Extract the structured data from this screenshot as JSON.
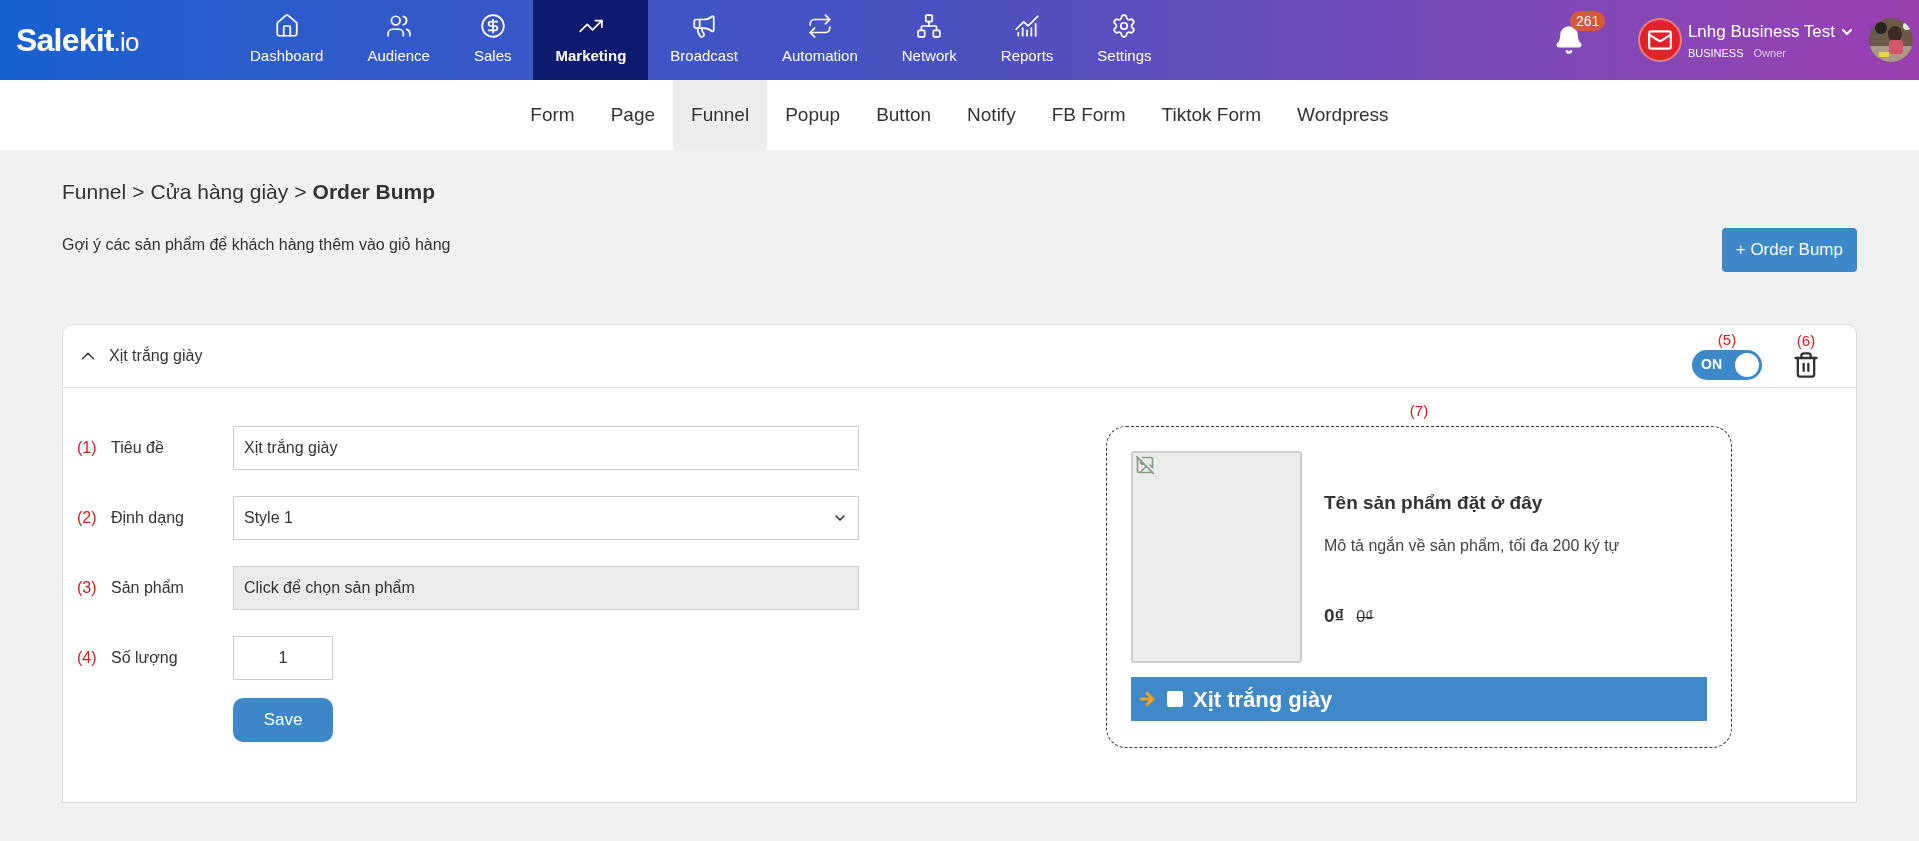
{
  "logo": {
    "name": "Salekit",
    "suffix": ".io"
  },
  "nav": [
    {
      "label": "Dashboard",
      "selected": false
    },
    {
      "label": "Audience",
      "selected": false
    },
    {
      "label": "Sales",
      "selected": false
    },
    {
      "label": "Marketing",
      "selected": true
    },
    {
      "label": "Broadcast",
      "selected": false
    },
    {
      "label": "Automation",
      "selected": false
    },
    {
      "label": "Network",
      "selected": false
    },
    {
      "label": "Reports",
      "selected": false
    },
    {
      "label": "Settings",
      "selected": false
    }
  ],
  "notifications": {
    "count": "261"
  },
  "account": {
    "name": "Lnhg Business Test",
    "plan": "BUSINESS",
    "role": "Owner"
  },
  "subnav": [
    {
      "label": "Form",
      "selected": false
    },
    {
      "label": "Page",
      "selected": false
    },
    {
      "label": "Funnel",
      "selected": true
    },
    {
      "label": "Popup",
      "selected": false
    },
    {
      "label": "Button",
      "selected": false
    },
    {
      "label": "Notify",
      "selected": false
    },
    {
      "label": "FB Form",
      "selected": false
    },
    {
      "label": "Tiktok Form",
      "selected": false
    },
    {
      "label": "Wordpress",
      "selected": false
    }
  ],
  "breadcrumb": [
    {
      "label": "Funnel",
      "current": false
    },
    {
      "label": "Cửa hàng giày",
      "current": false
    },
    {
      "label": "Order Bump",
      "current": true
    }
  ],
  "breadcrumb_separator": ">",
  "description": "Gợi ý các sản phẩm để khách hàng thêm vào giỏ hàng",
  "add_button": "+ Order Bump",
  "panel": {
    "title": "Xịt trắng giày",
    "expanded": true,
    "toggle_marker": "(5)",
    "toggle": {
      "label": "ON",
      "on": true
    },
    "delete_marker": "(6)",
    "fields": [
      {
        "marker": "(1)",
        "label": "Tiêu đề",
        "kind": "text",
        "value": "Xịt trắng giày"
      },
      {
        "marker": "(2)",
        "label": "Định dạng",
        "kind": "select",
        "value": "Style 1"
      },
      {
        "marker": "(3)",
        "label": "Sản phẩm",
        "kind": "readonly",
        "value": "Click để chọn sản phẩm"
      },
      {
        "marker": "(4)",
        "label": "Số lượng",
        "kind": "number",
        "value": "1"
      }
    ],
    "save_button": "Save",
    "preview": {
      "marker": "(7)",
      "product_name": "Tên sản phẩm đặt ở đây",
      "product_description": "Mô tả ngắn về sản phẩm, tối đa 200 ký tự",
      "price": "0₫",
      "old_price": "0₫",
      "bump_label": "Xịt trắng giày",
      "checked": false
    }
  }
}
